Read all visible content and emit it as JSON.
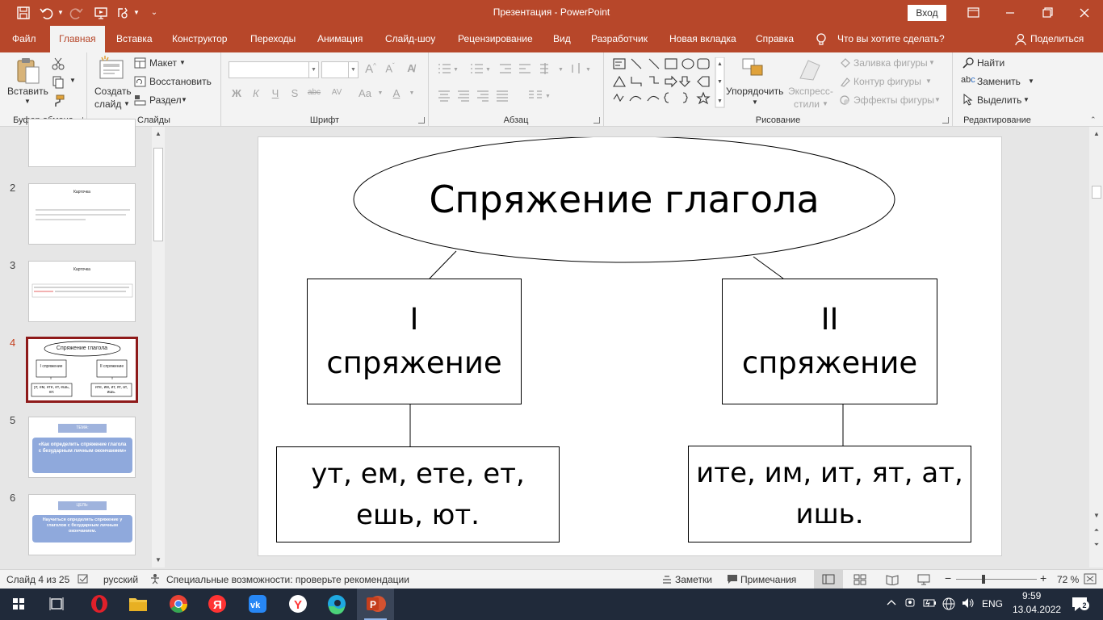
{
  "app": {
    "doc_title": "Презентация  -  PowerPoint",
    "signin": "Вход",
    "accent": "#b7472a"
  },
  "tabs": [
    {
      "label": "Файл"
    },
    {
      "label": "Главная"
    },
    {
      "label": "Вставка"
    },
    {
      "label": "Конструктор"
    },
    {
      "label": "Переходы"
    },
    {
      "label": "Анимация"
    },
    {
      "label": "Слайд-шоу"
    },
    {
      "label": "Рецензирование"
    },
    {
      "label": "Вид"
    },
    {
      "label": "Разработчик"
    },
    {
      "label": "Новая вкладка"
    },
    {
      "label": "Справка"
    }
  ],
  "tell_me": "Что вы хотите сделать?",
  "share": "Поделиться",
  "ribbon": {
    "clipboard": {
      "label": "Буфер обмена",
      "paste": "Вставить"
    },
    "slides": {
      "label": "Слайды",
      "new_slide_1": "Создать",
      "new_slide_2": "слайд",
      "layout": "Макет",
      "reset": "Восстановить",
      "section": "Раздел"
    },
    "font": {
      "label": "Шрифт"
    },
    "paragraph": {
      "label": "Абзац"
    },
    "drawing": {
      "label": "Рисование",
      "arrange": "Упорядочить",
      "quick_styles_1": "Экспресс-",
      "quick_styles_2": "стили",
      "fill": "Заливка фигуры",
      "outline": "Контур фигуры",
      "effects": "Эффекты фигуры"
    },
    "editing": {
      "label": "Редактирование",
      "find": "Найти",
      "replace": "Заменить",
      "select": "Выделить"
    }
  },
  "thumbnails": [
    {
      "num": "",
      "title": ""
    },
    {
      "num": "2",
      "title": "Карточка"
    },
    {
      "num": "3",
      "title": "Карточка"
    },
    {
      "num": "4",
      "title": "Спряжение глагола",
      "left_label": "I спряжение",
      "right_label": "II спряжение",
      "left_endings": "ут, ем, ете, ет, ешь, ют.",
      "right_endings": "ите, им, ит, ят, ат, ишь."
    },
    {
      "num": "5",
      "badge": "ТЕМА:",
      "body": "«Как определить спряжение глагола с безударным личным окончанием»"
    },
    {
      "num": "6",
      "badge": "ЦЕЛЬ:",
      "body": "Научиться определять спряжение у глаголов с безударным личным окончанием."
    }
  ],
  "slide": {
    "title": "Спряжение глагола",
    "left_numeral": "I",
    "left_word": "спряжение",
    "right_numeral": "II",
    "right_word": "спряжение",
    "left_endings_1": "ут, ем, ете, ет,",
    "left_endings_2": "ешь, ют.",
    "right_endings_1": "ите, им, ит, ят, ат,",
    "right_endings_2": "ишь."
  },
  "status": {
    "slide_counter": "Слайд 4 из 25",
    "language": "русский",
    "accessibility": "Специальные возможности: проверьте рекомендации",
    "notes": "Заметки",
    "comments": "Примечания",
    "zoom": "72 %"
  },
  "taskbar": {
    "lang": "ENG",
    "time": "9:59",
    "date": "13.04.2022",
    "notifications": "2"
  }
}
